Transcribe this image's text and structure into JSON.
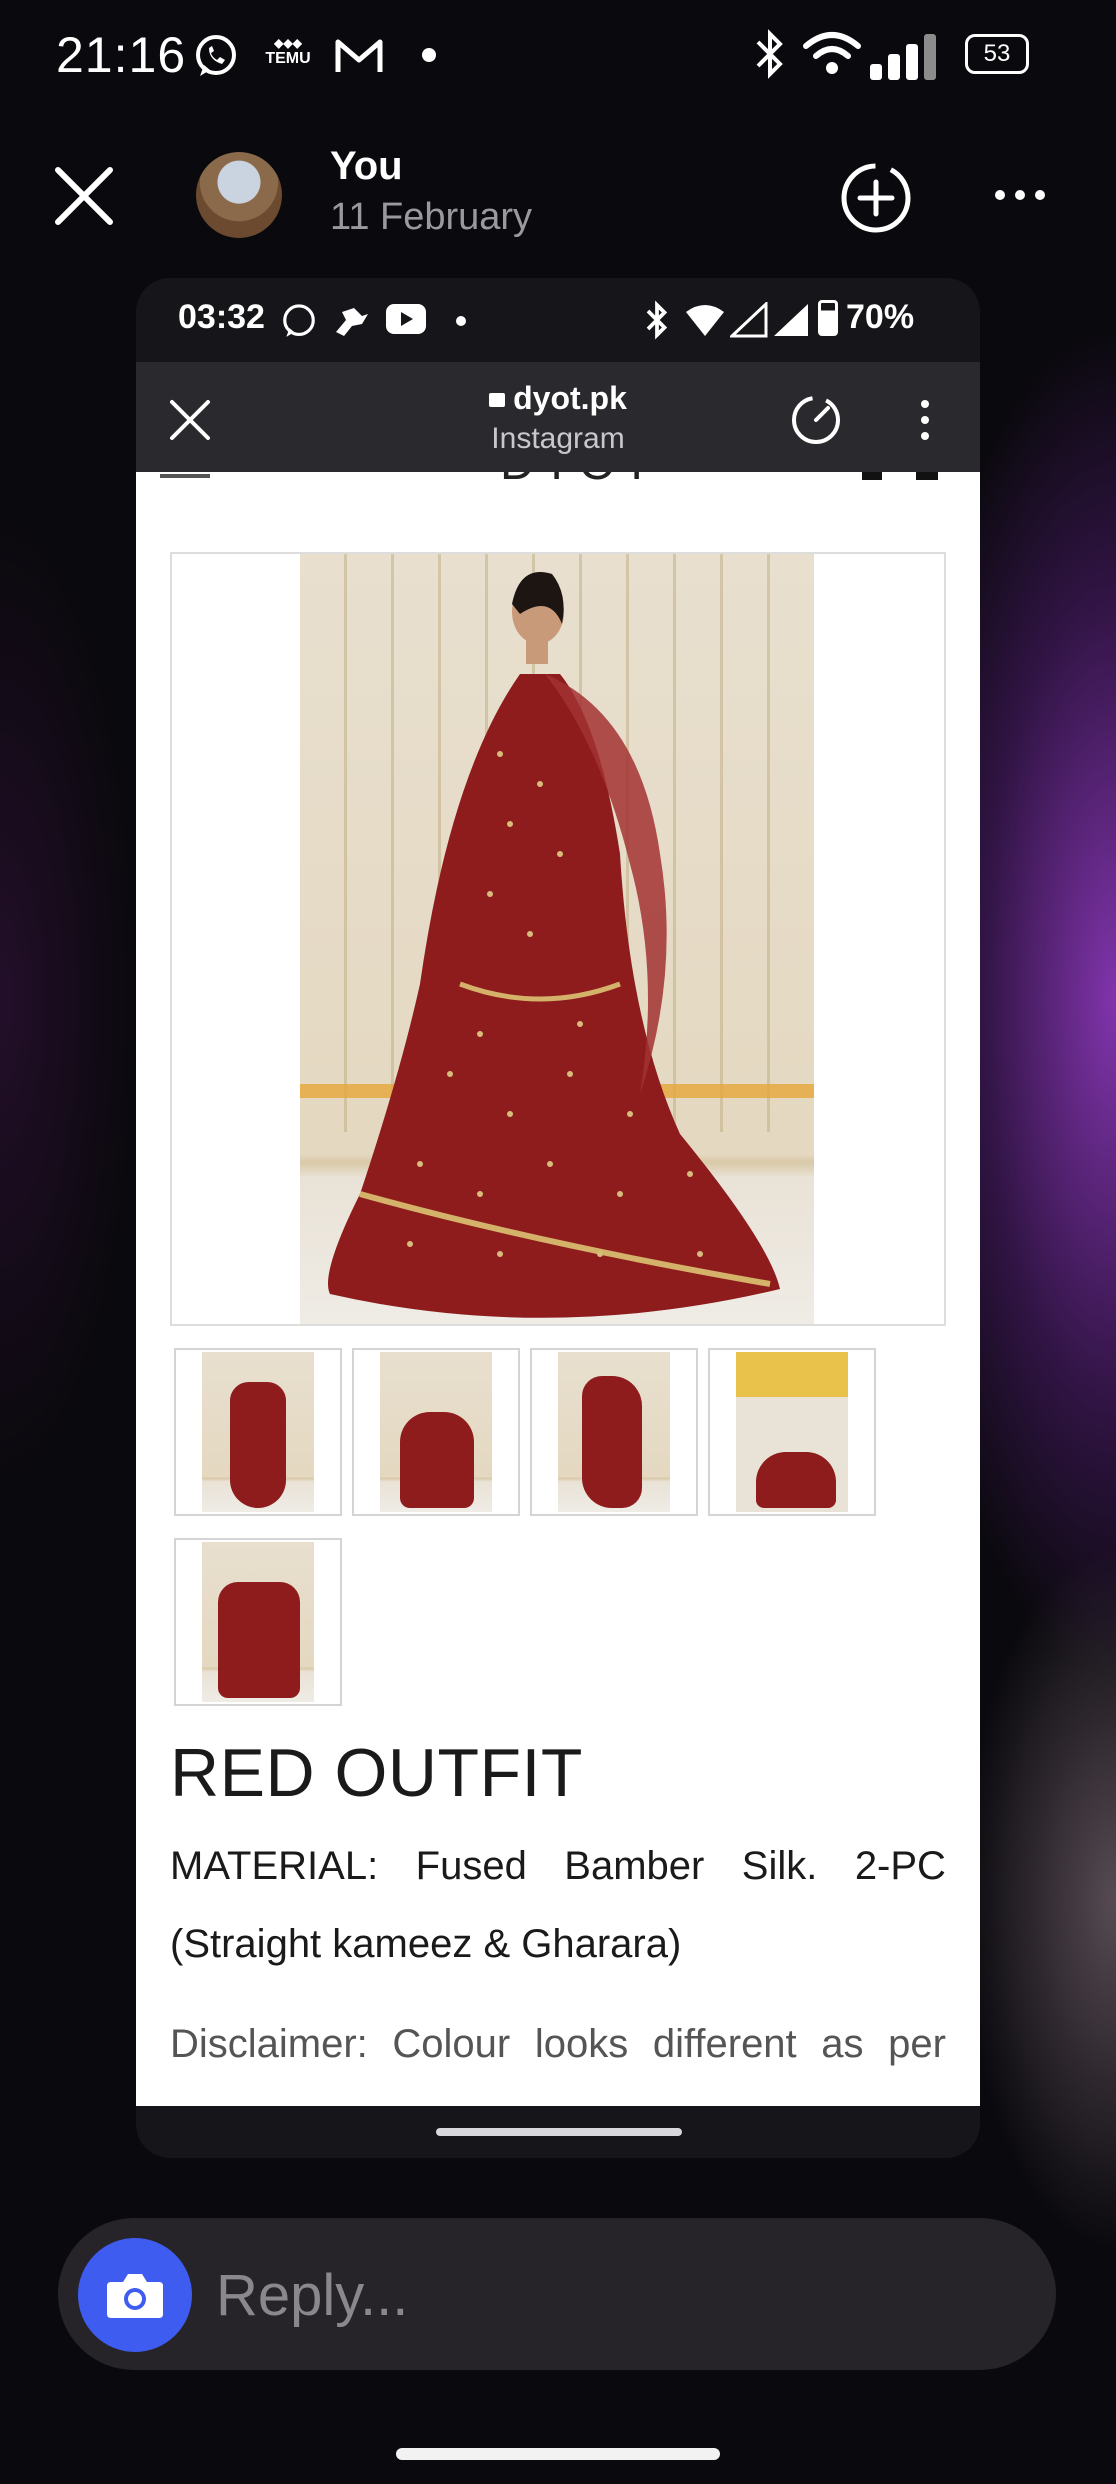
{
  "status_bar": {
    "time": "21:16",
    "temu_label": "TEMU",
    "battery": "53",
    "icons": [
      "whatsapp-icon",
      "temu-icon",
      "gmail-icon",
      "dot-icon",
      "bluetooth-icon",
      "wifi-icon",
      "signal-icon",
      "battery-icon"
    ]
  },
  "story": {
    "user": "You",
    "date": "11 February",
    "icons": [
      "close-icon",
      "add-circle-icon",
      "more-icon"
    ]
  },
  "inner_status_bar": {
    "time": "03:32",
    "battery": "70%"
  },
  "browser": {
    "url": "dyot.pk",
    "source": "Instagram",
    "site_logo": "DYOT"
  },
  "product": {
    "title": "RED OUTFIT",
    "material_line1_parts": [
      "MATERIAL:",
      "Fused",
      "Bamber",
      "Silk.",
      "2-PC"
    ],
    "material_line2": "(Straight kameez & Gharara)",
    "disclaimer_parts": [
      "Disclaimer:",
      "Colour",
      "looks",
      "different",
      "as",
      "per"
    ],
    "thumbnail_count": 5
  },
  "reply": {
    "placeholder": "Reply..."
  },
  "colors": {
    "accent": "#3f5cf0",
    "outfit_red": "#8e1c1c",
    "glow_purple": "#9a3cd0"
  }
}
